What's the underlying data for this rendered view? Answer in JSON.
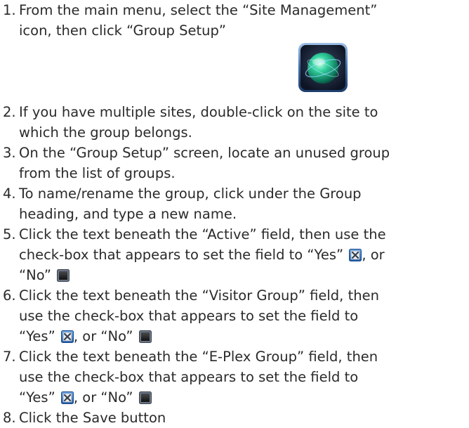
{
  "steps": [
    {
      "number": "1.",
      "lines": [
        "From the main menu, select the “Site Management”",
        "icon, then click “Group Setup”"
      ],
      "icon": "site-management-icon"
    },
    {
      "number": "2.",
      "lines": [
        "If you have multiple sites, double-click on the site to",
        "which the group belongs."
      ]
    },
    {
      "number": "3.",
      "lines": [
        "On the “Group Setup” screen, locate an unused group",
        "from the list of groups."
      ]
    },
    {
      "number": "4.",
      "lines": [
        "To name/rename the group, click under the Group",
        "heading, and type a new name."
      ]
    },
    {
      "number": "5.",
      "lines": [
        "Click the text beneath the “Active” field, then use the",
        "check-box that appears to set the field to “Yes”",
        ", or",
        "“No”"
      ]
    },
    {
      "number": "6.",
      "lines": [
        "Click the text beneath the “Visitor Group” field, then",
        "use the check-box that appears to set the field to",
        "“Yes”",
        ", or “No”"
      ]
    },
    {
      "number": "7.",
      "lines": [
        "Click the text beneath the “E-Plex Group” field, then",
        "use the check-box that appears to set the field to",
        "“Yes”",
        ", or “No”"
      ]
    },
    {
      "number": "8.",
      "lines": [
        "Click the Save button"
      ]
    }
  ],
  "icons": {
    "checkbox_checked": "checked-checkbox-icon",
    "checkbox_unchecked": "unchecked-checkbox-icon"
  },
  "colors": {
    "text": "#2a2a2a",
    "checkbox_checked_fill": "#2f6fc0",
    "checkbox_unchecked_fill": "#1e1e1e",
    "icon_glow": "#29b98a"
  }
}
